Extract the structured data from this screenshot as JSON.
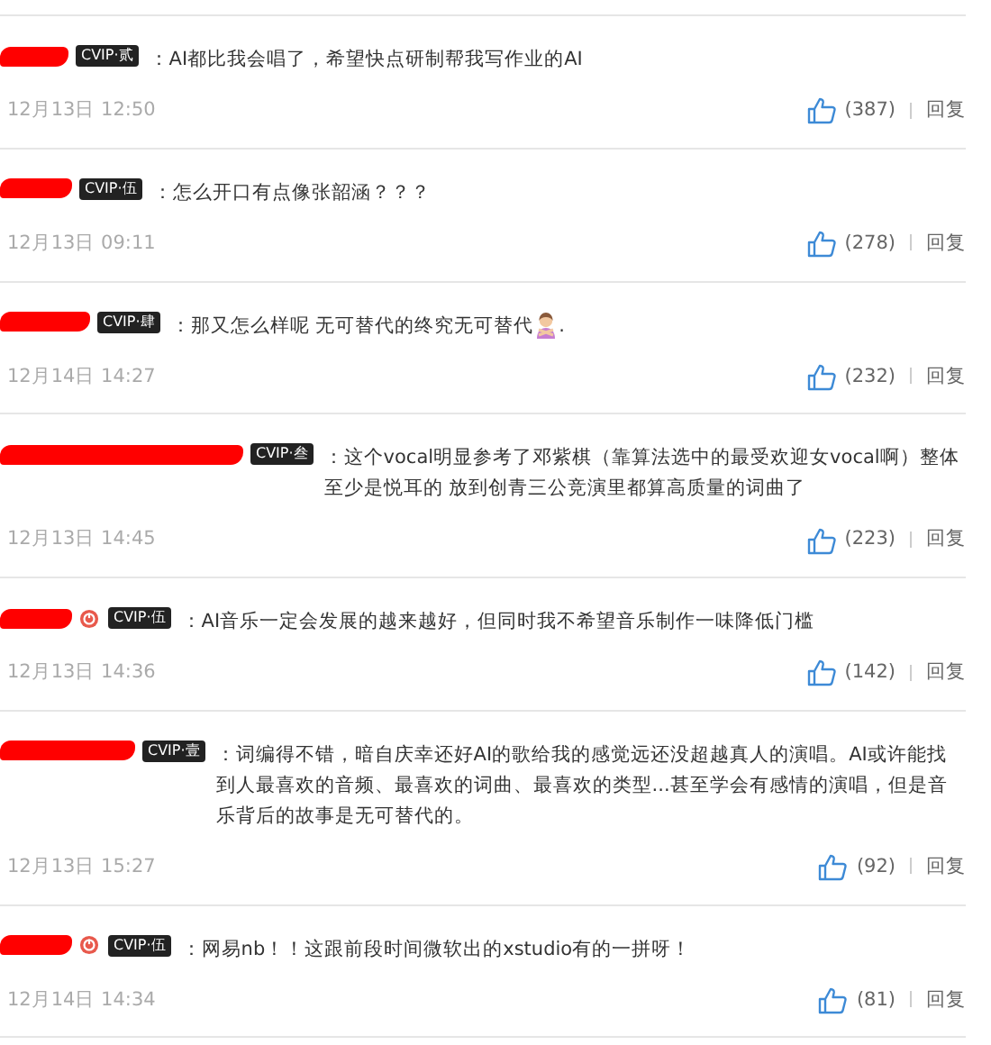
{
  "comments": [
    {
      "author": {
        "redacted": true,
        "verified": false,
        "badge": "CVIP·贰"
      },
      "text": "：AI都比我会唱了，希望快点研制帮我写作业的AI",
      "emoji": false,
      "date": "12月13日 12:50",
      "likes": "(387)",
      "reply": "回复"
    },
    {
      "author": {
        "redacted": true,
        "verified": false,
        "badge": "CVIP·伍"
      },
      "text": "：怎么开口有点像张韶涵？？？",
      "emoji": false,
      "date": "12月13日 09:11",
      "likes": "(278)",
      "reply": "回复"
    },
    {
      "author": {
        "redacted": true,
        "verified": false,
        "badge": "CVIP·肆"
      },
      "text": "：那又怎么样呢 无可替代的终究无可替代",
      "emoji": true,
      "text_after": ".",
      "date": "12月14日 14:27",
      "likes": "(232)",
      "reply": "回复"
    },
    {
      "author": {
        "redacted": true,
        "verified": false,
        "badge": "CVIP·叁"
      },
      "text": "：这个vocal明显参考了邓紫棋（靠算法选中的最受欢迎女vocal啊）整体至少是悦耳的 放到创青三公竞演里都算高质量的词曲了",
      "emoji": false,
      "date": "12月13日 14:45",
      "likes": "(223)",
      "reply": "回复"
    },
    {
      "author": {
        "redacted": true,
        "verified": true,
        "badge": "CVIP·伍"
      },
      "text": "：AI音乐一定会发展的越来越好，但同时我不希望音乐制作一味降低门槛",
      "emoji": false,
      "date": "12月13日 14:36",
      "likes": "(142)",
      "reply": "回复"
    },
    {
      "author": {
        "redacted": true,
        "verified": false,
        "badge": "CVIP·壹"
      },
      "text": "：词编得不错，暗自庆幸还好AI的歌给我的感觉远还没超越真人的演唱。AI或许能找到人最喜欢的音频、最喜欢的词曲、最喜欢的类型...甚至学会有感情的演唱，但是音乐背后的故事是无可替代的。",
      "emoji": false,
      "date": "12月13日 15:27",
      "likes": "(92)",
      "reply": "回复"
    },
    {
      "author": {
        "redacted": true,
        "verified": true,
        "badge": "CVIP·伍"
      },
      "text": "：网易nb！！这跟前段时间微软出的xstudio有的一拼呀！",
      "emoji": false,
      "date": "12月14日 14:34",
      "likes": "(81)",
      "reply": "回复"
    }
  ]
}
